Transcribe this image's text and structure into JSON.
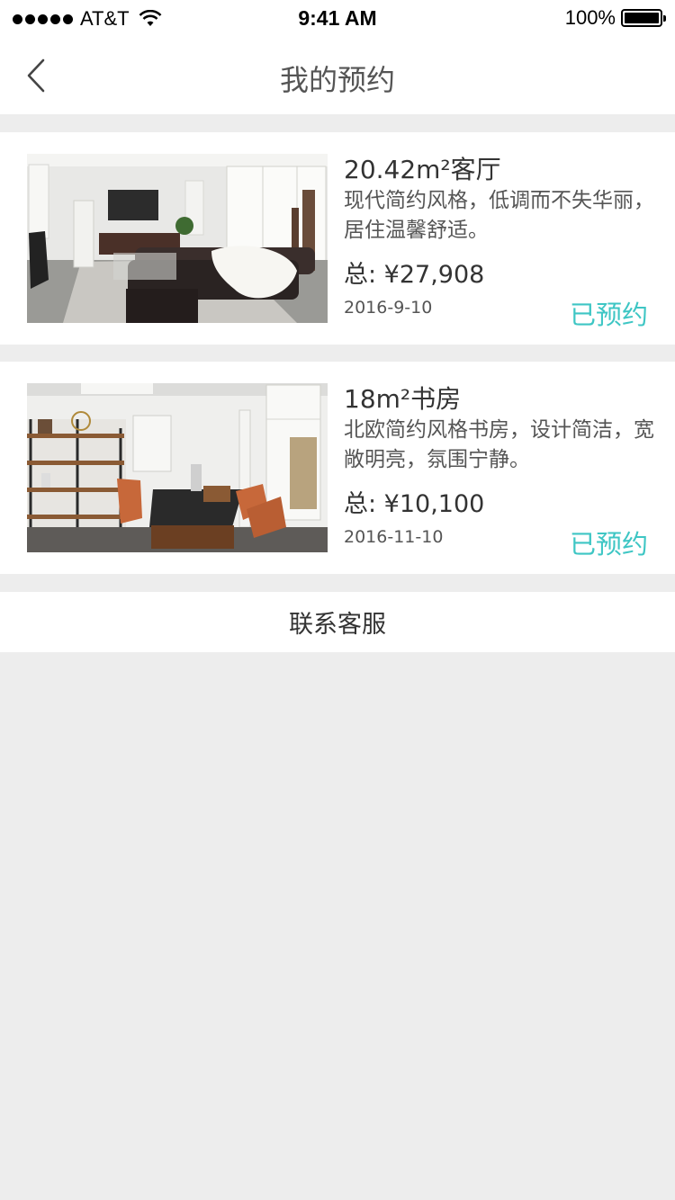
{
  "status_bar": {
    "carrier": "AT&T",
    "time": "9:41 AM",
    "battery": "100%",
    "icons": [
      "signal-icon",
      "wifi-icon",
      "battery-icon"
    ]
  },
  "nav": {
    "title": "我的预约",
    "back_icon": "chevron-left-icon"
  },
  "reservations": [
    {
      "title": "20.42m²客厅",
      "description": "现代简约风格，低调而不失华丽，居住温馨舒适。",
      "price": "总: ¥27,908",
      "date": "2016-9-10",
      "status": "已预约",
      "image": "living-room-photo"
    },
    {
      "title": "18m²书房",
      "description": "北欧简约风格书房，设计简洁，宽敞明亮，氛围宁静。",
      "price": "总: ¥10,100",
      "date": "2016-11-10",
      "status": "已预约",
      "image": "study-room-photo"
    }
  ],
  "contact": {
    "label": "联系客服"
  },
  "colors": {
    "accent": "#3ec6c4",
    "background": "#ededed",
    "card": "#ffffff"
  }
}
